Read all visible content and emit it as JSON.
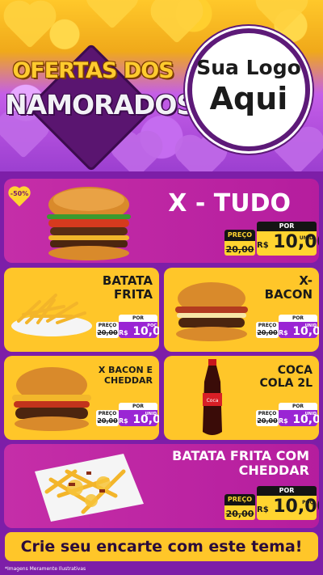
{
  "header": {
    "title_line1": "OFERTAS DOS",
    "title_line2": "NAMORADOS",
    "logo_line1": "Sua Logo",
    "logo_line2": "Aqui"
  },
  "colors": {
    "magenta": "#c52ea8",
    "yellow": "#ffc629",
    "purple": "#9a25d4",
    "dark": "#141414"
  },
  "badge": "-50%",
  "products": [
    {
      "name": "X - TUDO",
      "preco_label": "PREÇO",
      "old_price": "20,00",
      "por_label": "POR",
      "currency": "R$",
      "price": "10,00",
      "unit": "UNID",
      "icon": "burger-icon"
    },
    {
      "name": "BATATA FRITA",
      "preco_label": "PREÇO",
      "old_price": "20,00",
      "por_label": "POR",
      "currency": "R$",
      "price": "10,00",
      "unit": "POÇ",
      "icon": "fries-icon"
    },
    {
      "name": "X- BACON",
      "preco_label": "PREÇO",
      "old_price": "20,00",
      "por_label": "POR",
      "currency": "R$",
      "price": "10,00",
      "unit": "UNID",
      "icon": "burger-icon"
    },
    {
      "name": "X BACON E CHEDDAR",
      "preco_label": "PREÇO",
      "old_price": "20,00",
      "por_label": "POR",
      "currency": "R$",
      "price": "10,00",
      "unit": "UNID",
      "icon": "burger-icon"
    },
    {
      "name": "COCA COLA 2L",
      "preco_label": "PREÇO",
      "old_price": "20,00",
      "por_label": "POR",
      "currency": "R$",
      "price": "10,00",
      "unit": "UNID",
      "icon": "soda-bottle-icon"
    },
    {
      "name": "BATATA FRITA COM CHEDDAR",
      "preco_label": "PREÇO",
      "old_price": "20,00",
      "por_label": "POR",
      "currency": "R$",
      "price": "10,00",
      "unit": "POÇ",
      "icon": "fries-cheddar-icon"
    }
  ],
  "cta": "Crie seu encarte com este tema!",
  "footnote": "*Imagens Meramente Ilustrativas"
}
